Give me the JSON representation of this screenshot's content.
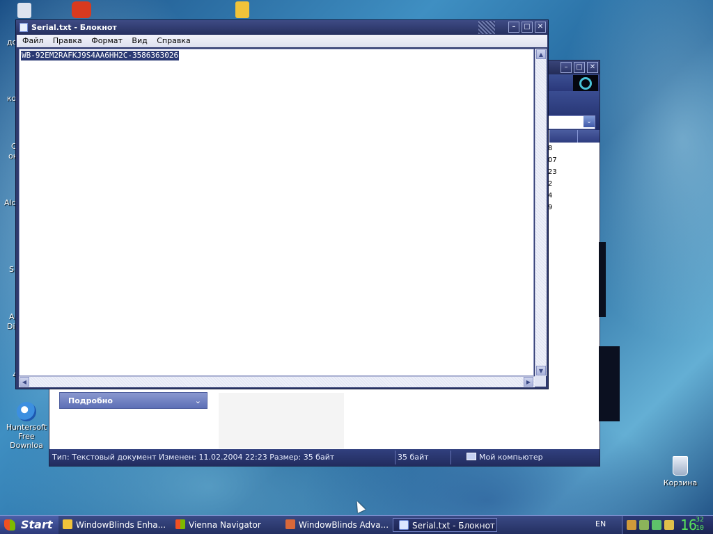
{
  "desktop": {
    "fragments": [
      "до",
      "ко",
      "С",
      "ок",
      "Alc",
      "S",
      "A",
      "Dis",
      "4"
    ],
    "ie_icon_label_1": "Huntersoft",
    "ie_icon_label_2": "Free Downloa",
    "recycle_label": "Корзина"
  },
  "back_window": {
    "title_buttons": [
      "–",
      "□",
      "✕"
    ],
    "column_fragments": [
      "8",
      "07",
      "23",
      "2",
      "4",
      "9"
    ],
    "detail_panel_label": "Подробно",
    "detail_chevron": "⌄",
    "status": {
      "info": "Тип: Текстовый документ Изменен: 11.02.2004 22:23 Размер: 35 байт",
      "size": "35 байт",
      "location": "Мой компьютер"
    },
    "addr_drop": "⌄"
  },
  "notepad": {
    "title": "Serial.txt - Блокнот",
    "title_buttons": [
      "–",
      "□",
      "✕"
    ],
    "menu": [
      "Файл",
      "Правка",
      "Формат",
      "Вид",
      "Справка"
    ],
    "content": "WB-92EM2RAFKJ9S4AA6HH2C-3586363026",
    "scroll_up": "▲",
    "scroll_down": "▼",
    "scroll_left": "◀",
    "scroll_right": "▶"
  },
  "taskbar": {
    "start_label": "Start",
    "tasks": [
      "WindowBlinds Enha...",
      "Vienna Navigator",
      "WindowBlinds Adva...",
      "Serial.txt - Блокнот"
    ],
    "language": "EN",
    "clock": {
      "hours": "16",
      "minutes": "32",
      "seconds": "10"
    }
  },
  "colors": {
    "accent": "#2f3a6e",
    "selection": "#2a3973",
    "clock": "#57e35b"
  }
}
